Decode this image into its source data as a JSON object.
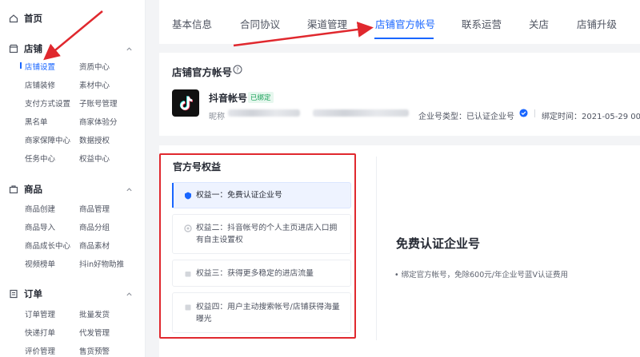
{
  "sidebar": {
    "home": "首页",
    "store": {
      "title": "店铺",
      "items": [
        "店铺设置",
        "资质中心",
        "店铺装修",
        "素材中心",
        "支付方式设置",
        "子账号管理",
        "黑名单",
        "商家体验分",
        "商家保障中心",
        "数据授权",
        "任务中心",
        "权益中心"
      ],
      "active": "店铺设置"
    },
    "goods": {
      "title": "商品",
      "items": [
        "商品创建",
        "商品管理",
        "商品导入",
        "商品分组",
        "商品成长中心",
        "商品素材",
        "视频榜单",
        "抖in好物助推"
      ]
    },
    "orders": {
      "title": "订单",
      "items": [
        "订单管理",
        "批量发货",
        "快递打单",
        "代发管理",
        "评价管理",
        "售货预警"
      ]
    }
  },
  "tabs": [
    "基本信息",
    "合同协议",
    "渠道管理",
    "店铺官方帐号",
    "联系运营",
    "关店",
    "店铺升级"
  ],
  "active_tab": "店铺官方帐号",
  "account": {
    "title": "店铺官方帐号",
    "name": "抖音帐号",
    "badge": "已绑定",
    "nickname_label": "昵称",
    "enterprise_type": "企业号类型：已认证企业号",
    "bind_time": "绑定时间：2021-05-29 00"
  },
  "rights": {
    "title": "官方号权益",
    "benefits": [
      "权益一：免费认证企业号",
      "权益二：抖音帐号的个人主页进店入口拥有自主设置权",
      "权益三：获得更多稳定的进店流量",
      "权益四：用户主动搜索帐号/店铺获得海量曝光"
    ],
    "detail_title": "免费认证企业号",
    "detail_desc": "• 绑定官方帐号，免除600元/年企业号蓝V认证费用"
  },
  "colors": {
    "primary": "#1966ff",
    "annotation_red": "#e0282e",
    "verified_green": "#18a058"
  }
}
